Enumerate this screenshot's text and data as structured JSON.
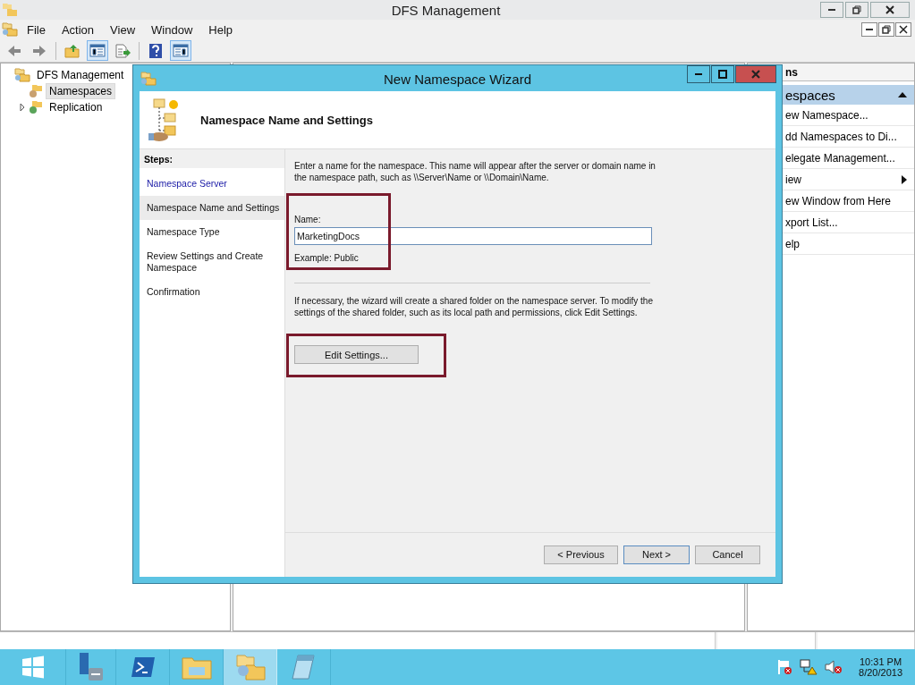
{
  "window": {
    "title": "DFS Management"
  },
  "menu": [
    "File",
    "Action",
    "View",
    "Window",
    "Help"
  ],
  "toolbar": [
    {
      "kind": "back",
      "pressed": false
    },
    {
      "kind": "forward",
      "pressed": false
    },
    {
      "kind": "sep"
    },
    {
      "kind": "up",
      "pressed": false
    },
    {
      "kind": "tree",
      "pressed": true
    },
    {
      "kind": "export",
      "pressed": false
    },
    {
      "kind": "sep"
    },
    {
      "kind": "help",
      "pressed": false
    },
    {
      "kind": "actions",
      "pressed": true
    }
  ],
  "tree": [
    {
      "label": "DFS Management",
      "children": [
        {
          "label": "Namespaces",
          "selected": true
        },
        {
          "label": "Replication",
          "selected": false,
          "expanded": false
        }
      ]
    }
  ],
  "actions_pane": {
    "header": "ns",
    "section": "espaces",
    "items": [
      {
        "label": "ew Namespace...",
        "submenu": false
      },
      {
        "label": "dd Namespaces to Di...",
        "submenu": false
      },
      {
        "label": "elegate Management...",
        "submenu": false
      },
      {
        "label": "iew",
        "submenu": true
      },
      {
        "label": "ew Window from Here",
        "submenu": false
      },
      {
        "label": "xport List...",
        "submenu": false
      },
      {
        "label": "elp",
        "submenu": false
      }
    ]
  },
  "wizard": {
    "title": "New Namespace Wizard",
    "heading": "Namespace Name and Settings",
    "steps_title": "Steps:",
    "steps": [
      {
        "label": "Namespace Server",
        "selected": false,
        "visited": true
      },
      {
        "label": "Namespace Name and Settings",
        "selected": true,
        "visited": false
      },
      {
        "label": "Namespace Type",
        "selected": false,
        "visited": false
      },
      {
        "label": "Review Settings and Create Namespace",
        "selected": false,
        "visited": false
      },
      {
        "label": "Confirmation",
        "selected": false,
        "visited": false
      }
    ],
    "intro": "Enter a name for the namespace. This name will appear after the server or domain name in the namespace path, such as \\\\Server\\Name or \\\\Domain\\Name.",
    "name_label": "Name:",
    "name_value": "MarketingDocs",
    "example": "Example: Public",
    "info": "If necessary, the wizard will create a shared folder on the namespace server. To modify the settings of the shared folder, such as its local path and permissions, click Edit Settings.",
    "edit_button": "Edit Settings...",
    "buttons": [
      "< Previous",
      "Next >",
      "Cancel"
    ]
  },
  "taskbar": {
    "apps": [
      {
        "kind": "server",
        "selected": false
      },
      {
        "kind": "shell",
        "selected": false
      },
      {
        "kind": "explorer",
        "selected": false
      },
      {
        "kind": "dfs",
        "selected": true
      },
      {
        "kind": "notepad",
        "selected": false
      }
    ],
    "time": "10:31 PM",
    "date": "8/20/2013"
  }
}
